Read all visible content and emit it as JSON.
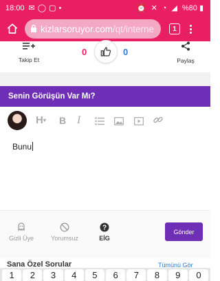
{
  "status_bar": {
    "time": "18:00",
    "battery": "%80"
  },
  "browser": {
    "url_main": "kizlarsoruyor.com",
    "url_rest": "/qt/interne",
    "tab_count": "1"
  },
  "actions": {
    "follow_label": "Takip Et",
    "like_count": "0",
    "dislike_count": "0",
    "share_label": "Paylaş"
  },
  "section": {
    "title": "Senin Görüşün Var Mı?"
  },
  "editor": {
    "text": "Bunu"
  },
  "options": {
    "anonymous_label": "Gizli Üye",
    "no_comment_label": "Yorumsuz",
    "eig_label": "EİG",
    "send_label": "Gönder"
  },
  "colors": {
    "brand_pink": "#e91e63",
    "purple": "#6e2fb6",
    "blue": "#2d7bd2"
  },
  "keyboard": {
    "keys": [
      "1",
      "2",
      "3",
      "4",
      "5",
      "6",
      "7",
      "8",
      "9",
      "0"
    ]
  }
}
